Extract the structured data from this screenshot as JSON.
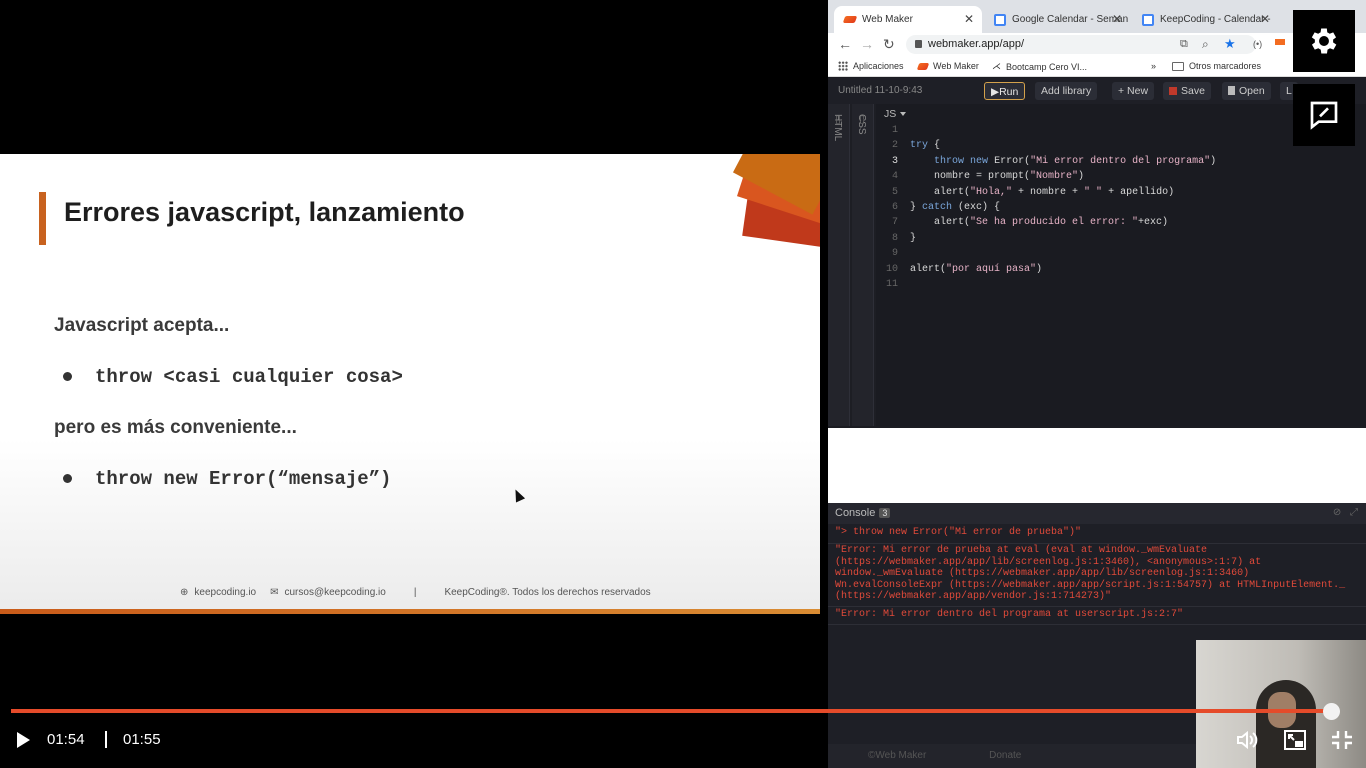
{
  "slide": {
    "title": "Errores javascript, lanzamiento",
    "line1": "Javascript acepta...",
    "bullet1": "throw <casi cualquier cosa>",
    "line2": "pero es más conveniente...",
    "bullet2": "throw new Error(“mensaje”)",
    "footer_site": "keepcoding.io",
    "footer_email": "cursos@keepcoding.io",
    "footer_sep": "|",
    "footer_rights": "KeepCoding®. Todos los derechos reservados",
    "accent_color": "#c8621f"
  },
  "browser": {
    "tabs": [
      {
        "label": "Web Maker",
        "active": true
      },
      {
        "label": "Google Calendar - Seman",
        "active": false
      },
      {
        "label": "KeepCoding - Calendar -",
        "active": false
      }
    ],
    "url": "webmaker.app/app/",
    "bookmarks": {
      "apps": "Aplicaciones",
      "webmaker": "Web Maker",
      "bootcamp": "Bootcamp Cero VI...",
      "more": "»",
      "others": "Otros marcadores"
    }
  },
  "webmaker": {
    "project_title": "Untitled 11-10-9:43",
    "buttons": {
      "run": "Run",
      "add_library": "Add library",
      "new": "+ New",
      "save": "Save",
      "open": "Open",
      "login": "L"
    },
    "panes": {
      "html": "HTML",
      "css": "CSS",
      "js": "JS"
    },
    "code_lines": [
      {
        "n": "1",
        "text": ""
      },
      {
        "n": "2",
        "text": "try {"
      },
      {
        "n": "3",
        "text": "    throw new Error(\"Mi error dentro del programa\")"
      },
      {
        "n": "4",
        "text": "    nombre = prompt(\"Nombre\")"
      },
      {
        "n": "5",
        "text": "    alert(\"Hola,\" + nombre + \" \" + apellido)"
      },
      {
        "n": "6",
        "text": "} catch (exc) {"
      },
      {
        "n": "7",
        "text": "    alert(\"Se ha producido el error: \"+exc)"
      },
      {
        "n": "8",
        "text": "}"
      },
      {
        "n": "9",
        "text": ""
      },
      {
        "n": "10",
        "text": "alert(\"por aquí pasa\")"
      },
      {
        "n": "11",
        "text": ""
      }
    ],
    "console": {
      "title": "Console",
      "count": "3",
      "logs": [
        "\"> throw new Error(\"Mi error de prueba\")\"",
        "\"Error: Mi error de prueba at eval (eval at window._wmEvaluate\n(https://webmaker.app/app/lib/screenlog.js:1:3460), <anonymous>:1:7) at\nwindow._wmEvaluate (https://webmaker.app/app/lib/screenlog.js:1:3460)\nWn.evalConsoleExpr (https://webmaker.app/app/script.js:1:54757) at HTMLInputElement._\n(https://webmaker.app/app/vendor.js:1:714273)\"",
        "\"Error: Mi error dentro del programa at userscript.js:2:7\""
      ]
    },
    "status": {
      "brand": "©Web Maker",
      "donate": "Donate"
    }
  },
  "player": {
    "current_time": "01:54",
    "duration": "01:55",
    "progress": 0.992,
    "accent": "#e54b2a"
  }
}
